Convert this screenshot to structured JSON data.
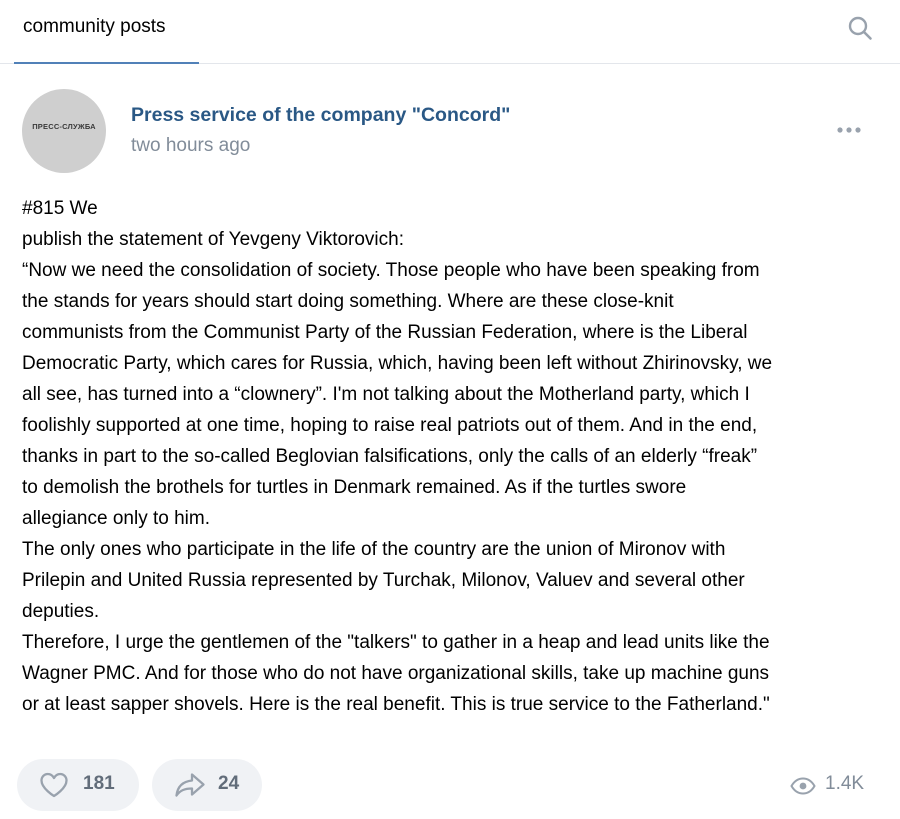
{
  "search": {
    "tab_label": "community posts"
  },
  "post": {
    "avatar_text": "ПРЕСС-СЛУЖБА",
    "author": "Press service of the company \"Concord\"",
    "time": "two hours ago",
    "lines": [
      "#815 We",
      "publish the statement of Yevgeny Viktorovich:",
      "“Now we need the consolidation of society. Those people who have been speaking from",
      "the stands for years should start doing something. Where are these close-knit",
      "communists from the Communist Party of the Russian Federation, where is the Liberal",
      "Democratic Party, which cares for Russia, which, having been left without Zhirinovsky, we",
      "all see, has turned into a “clownery”. I'm not talking about the Motherland party, which I",
      "foolishly supported at one time, hoping to raise real patriots out of them. And in the end,",
      "thanks in part to the so-called Beglovian falsifications, only the calls of an elderly “freak”",
      "to demolish the brothels for turtles in Denmark remained. As if the turtles swore",
      "allegiance only to him.",
      "The only ones who participate in the life of the country are the union of Mironov with",
      "Prilepin and United Russia represented by Turchak, Milonov, Valuev and several other",
      "deputies.",
      "Therefore, I urge the gentlemen of the \"talkers\" to gather in a heap and lead units like the",
      "Wagner PMC. And for those who do not have organizational skills, take up machine guns",
      "or at least sapper shovels. Here is the real benefit. This is true service to the Fatherland.\""
    ],
    "likes": "181",
    "shares": "24",
    "views": "1.4K"
  },
  "icons": {
    "search": "search-icon",
    "more": "more-dots-icon",
    "like": "heart-icon",
    "share": "share-arrow-icon",
    "views": "eye-icon"
  },
  "colors": {
    "accent": "#5181b8",
    "author_link": "#2a5885",
    "secondary_text": "#818c99",
    "pill_bg": "#f0f2f5",
    "icon_gray": "#99a2ad"
  }
}
